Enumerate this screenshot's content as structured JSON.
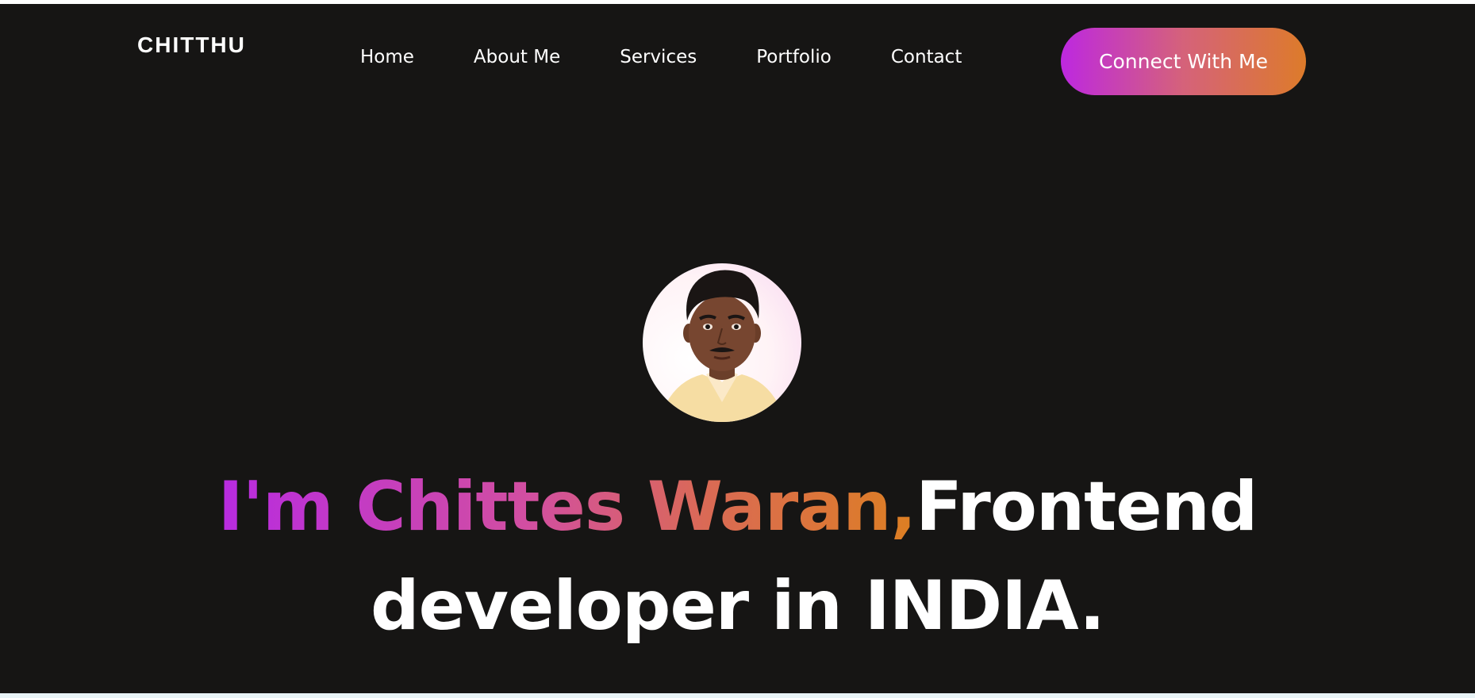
{
  "header": {
    "logo": "CHITTHU",
    "nav": [
      {
        "label": "Home"
      },
      {
        "label": "About Me"
      },
      {
        "label": "Services"
      },
      {
        "label": "Portfolio"
      },
      {
        "label": "Contact"
      }
    ],
    "cta_label": "Connect With Me"
  },
  "hero": {
    "avatar_icon": "profile-photo",
    "headline_highlight": "I'm Chittes Waran,",
    "headline_line1_rest": "Frontend",
    "headline_line2": "developer in INDIA."
  },
  "colors": {
    "background": "#161514",
    "gradient_start": "#bd28e0",
    "gradient_end": "#dd7b2a",
    "text": "#ffffff"
  }
}
